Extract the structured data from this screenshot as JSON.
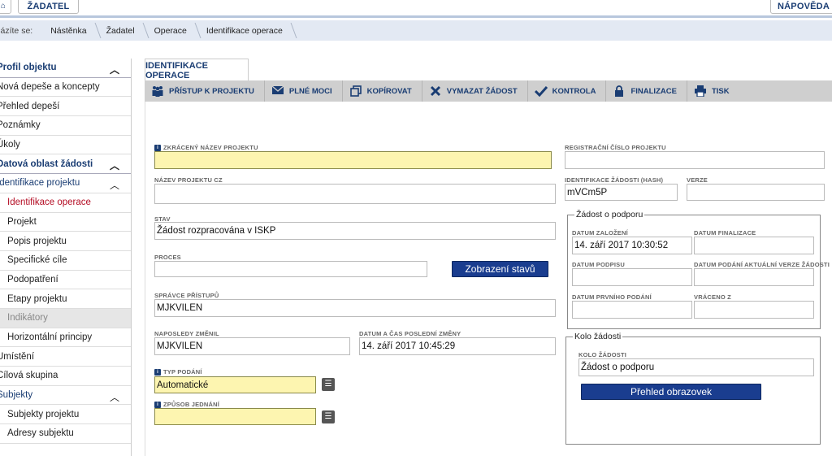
{
  "topbar": {
    "home_icon": "home-icon",
    "zadatel_label": "ŽADATEL",
    "napoveda_label": "NÁPOVĚDA"
  },
  "breadcrumb": {
    "label": "Nacházíte se:",
    "items": [
      "Nástěnka",
      "Žadatel",
      "Operace",
      "Identifikace operace"
    ]
  },
  "sidebar": {
    "items": [
      {
        "label": "Profil objektu"
      },
      {
        "label": "Nová depeše a koncepty"
      },
      {
        "label": "Přehled depeší"
      },
      {
        "label": "Poznámky"
      },
      {
        "label": "Úkoly"
      },
      {
        "label": "Datová oblast žádosti"
      },
      {
        "label": "Identifikace projektu"
      },
      {
        "label": "Identifikace operace"
      },
      {
        "label": "Projekt"
      },
      {
        "label": "Popis projektu"
      },
      {
        "label": "Specifické cíle"
      },
      {
        "label": "Podopatření"
      },
      {
        "label": "Etapy projektu"
      },
      {
        "label": "Indikátory"
      },
      {
        "label": "Horizontální principy"
      },
      {
        "label": "Umístění"
      },
      {
        "label": "Cílová skupina"
      },
      {
        "label": "Subjekty"
      },
      {
        "label": "Subjekty projektu"
      },
      {
        "label": "Adresy subjektu"
      }
    ]
  },
  "main": {
    "tab_label": "IDENTIFIKACE OPERACE",
    "toolbar": {
      "pristup": "PŘÍSTUP K PROJEKTU",
      "plne_moci": "PLNÉ MOCI",
      "kopirovat": "KOPÍROVAT",
      "vymazat": "VYMAZAT ŽÁDOST",
      "kontrola": "KONTROLA",
      "finalizace": "FINALIZACE",
      "tisk": "TISK"
    }
  },
  "form": {
    "zkraceny_nazev": {
      "label": "ZKRÁCENÝ NÁZEV PROJEKTU",
      "value": ""
    },
    "nazev_cz": {
      "label": "NÁZEV PROJEKTU CZ",
      "value": ""
    },
    "stav": {
      "label": "STAV",
      "value": "Žádost rozpracována v ISKP"
    },
    "proces": {
      "label": "PROCES",
      "value": ""
    },
    "zobrazeni_stavu_btn": "Zobrazení stavů",
    "spravce": {
      "label": "SPRÁVCE PŘÍSTUPŮ",
      "value": "MJKVILEN"
    },
    "naposledy_zmenil": {
      "label": "NAPOSLEDY ZMĚNIL",
      "value": "MJKVILEN"
    },
    "datum_zmeny": {
      "label": "DATUM A ČAS POSLEDNÍ ZMĚNY",
      "value": "14. září 2017 10:45:29"
    },
    "typ_podani": {
      "label": "TYP PODÁNÍ",
      "value": "Automatické"
    },
    "zpusob_jednani": {
      "label": "ZPŮSOB JEDNÁNÍ",
      "value": ""
    },
    "registracni_cislo": {
      "label": "REGISTRAČNÍ ČÍSLO PROJEKTU",
      "value": ""
    },
    "hash": {
      "label": "IDENTIFIKACE ŽÁDOSTI (HASH)",
      "value": "mVCm5P"
    },
    "verze": {
      "label": "VERZE",
      "value": ""
    },
    "zadost_group": {
      "title": "Žádost o podporu",
      "datum_zalozeni": {
        "label": "DATUM ZALOŽENÍ",
        "value": "14. září 2017 10:30:52"
      },
      "datum_finalizace": {
        "label": "DATUM FINALIZACE",
        "value": ""
      },
      "datum_podpisu": {
        "label": "DATUM PODPISU",
        "value": ""
      },
      "datum_podani_verze": {
        "label": "DATUM PODÁNÍ AKTUÁLNÍ VERZE ŽÁDOSTI",
        "value": ""
      },
      "datum_prvniho_podani": {
        "label": "DATUM PRVNÍHO PODÁNÍ",
        "value": ""
      },
      "vraceno_z": {
        "label": "VRÁCENO Z",
        "value": ""
      }
    },
    "kolo_group": {
      "title": "Kolo žádosti",
      "kolo": {
        "label": "KOLO ŽÁDOSTI",
        "value": "Žádost o podporu"
      },
      "prehled_btn": "Přehled obrazovek"
    }
  },
  "colors": {
    "brand_blue": "#1a3d73",
    "required_yellow": "#fdf5b0",
    "active_red": "#b40d24"
  }
}
